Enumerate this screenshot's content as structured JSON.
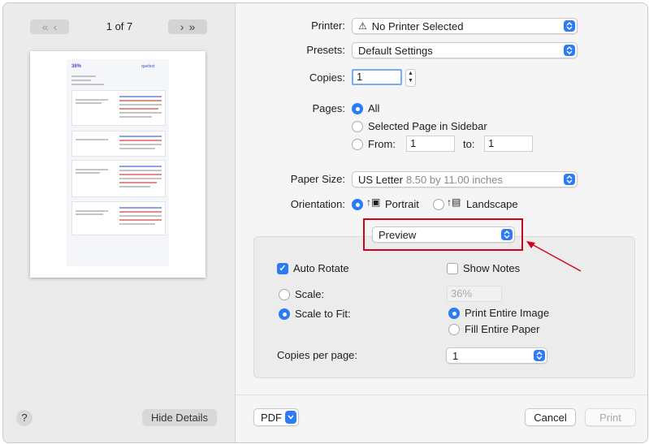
{
  "sidebar": {
    "page_indicator": "1 of 7",
    "help_label": "?",
    "hide_details_label": "Hide Details",
    "preview_logo_text": "36%",
    "preview_brand_text": "quetext"
  },
  "printer": {
    "label": "Printer:",
    "value": "No Printer Selected"
  },
  "presets": {
    "label": "Presets:",
    "value": "Default Settings"
  },
  "copies": {
    "label": "Copies:",
    "value": "1"
  },
  "pages": {
    "label": "Pages:",
    "all_label": "All",
    "selected_label": "Selected Page in Sidebar",
    "from_label": "From:",
    "from_value": "1",
    "to_label": "to:",
    "to_value": "1"
  },
  "paper_size": {
    "label": "Paper Size:",
    "value": "US Letter",
    "detail": "8.50 by 11.00 inches"
  },
  "orientation": {
    "label": "Orientation:",
    "portrait_label": "Portrait",
    "landscape_label": "Landscape"
  },
  "app_menu": {
    "value": "Preview"
  },
  "options": {
    "auto_rotate_label": "Auto Rotate",
    "show_notes_label": "Show Notes",
    "scale_label": "Scale:",
    "scale_value": "36%",
    "scale_to_fit_label": "Scale to Fit:",
    "print_entire_image_label": "Print Entire Image",
    "fill_entire_paper_label": "Fill Entire Paper",
    "copies_per_page_label": "Copies per page:",
    "copies_per_page_value": "1"
  },
  "footer": {
    "pdf_label": "PDF",
    "cancel_label": "Cancel",
    "print_label": "Print"
  },
  "colors": {
    "accent": "#2a7bf5",
    "annotation": "#d0021b"
  }
}
